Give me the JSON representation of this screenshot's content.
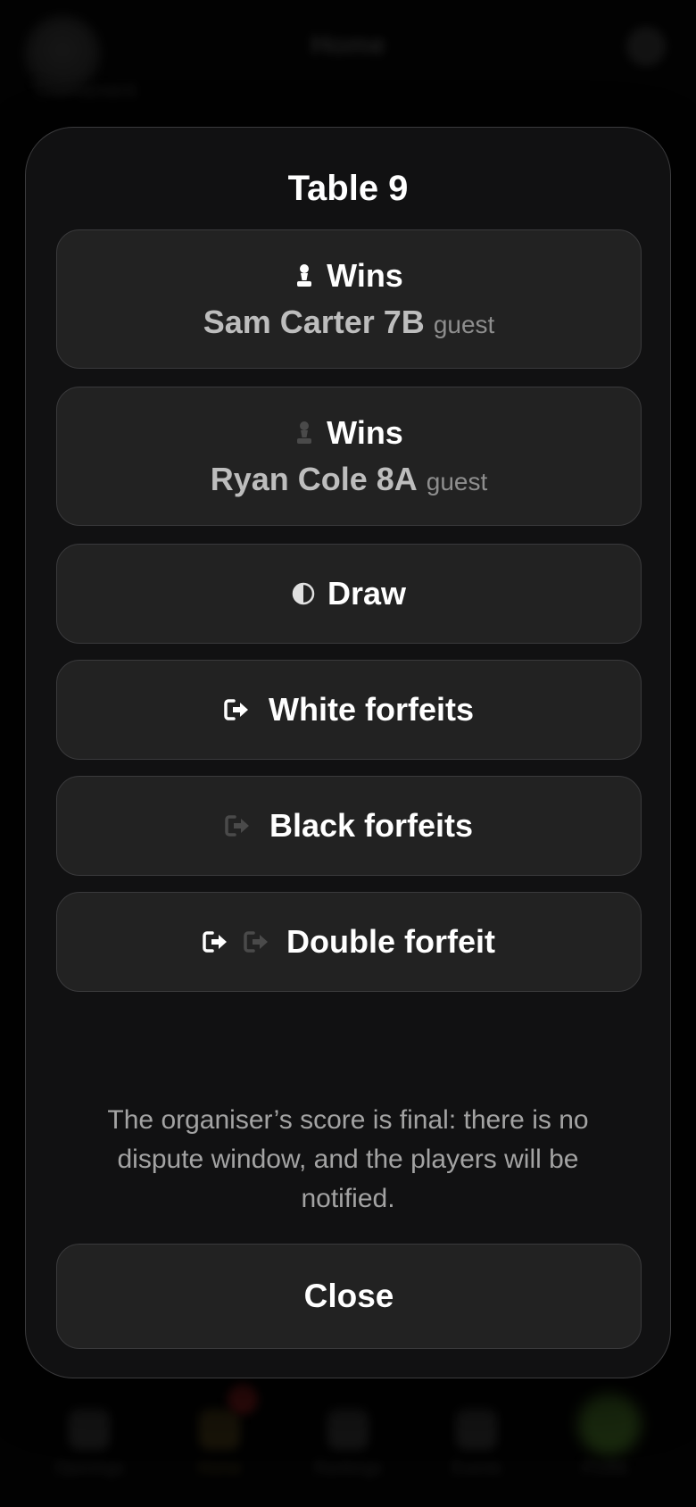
{
  "background": {
    "title": "Home",
    "subtitle": "Tournament",
    "tabs": [
      "Openings",
      "Home",
      "Rankings",
      "Events",
      "Profile"
    ]
  },
  "modal": {
    "title": "Table 9",
    "options": [
      {
        "label": "Wins",
        "player": "Sam Carter 7B",
        "tag": "guest",
        "icon": "white-pawn-icon"
      },
      {
        "label": "Wins",
        "player": "Ryan Cole 8A",
        "tag": "guest",
        "icon": "black-pawn-icon"
      },
      {
        "label": "Draw",
        "icon": "half-circle-icon"
      },
      {
        "label": "White forfeits",
        "icon": "white-exit-icon"
      },
      {
        "label": "Black forfeits",
        "icon": "black-exit-icon"
      },
      {
        "label": "Double forfeit",
        "icon": "double-exit-icon"
      }
    ],
    "note": "The organiser’s score is final: there is no dispute window, and the players will be notified.",
    "close_label": "Close"
  },
  "colors": {
    "modal_bg": "#121213",
    "option_bg": "#222222",
    "border": "#3a3a3c",
    "muted_text": "#a3a3a3"
  }
}
